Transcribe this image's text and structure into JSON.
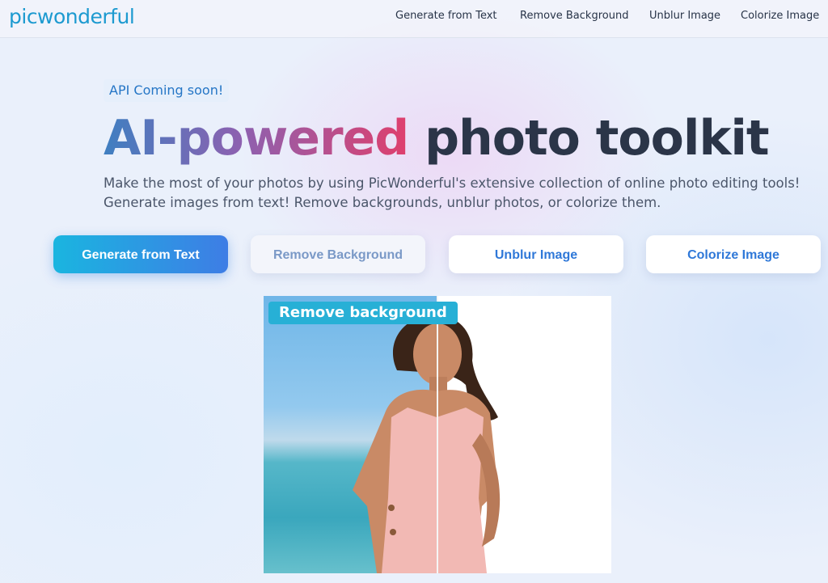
{
  "header": {
    "logo": "picwonderful",
    "nav": [
      "Generate from Text",
      "Remove Background",
      "Unblur Image",
      "Colorize Image"
    ]
  },
  "hero": {
    "badge": "API Coming soon!",
    "title_highlight": "AI-powered",
    "title_rest": "photo toolkit",
    "description_line1": "Make the most of your photos by using PicWonderful's extensive collection of online photo editing tools!",
    "description_line2": "Generate images from text! Remove backgrounds, unblur photos, or colorize them."
  },
  "tool_buttons": [
    "Generate from Text",
    "Remove Background",
    "Unblur Image",
    "Colorize Image"
  ],
  "demo": {
    "label": "Remove background",
    "image": "woman-in-pink-dress-photo"
  },
  "colors": {
    "brand": "#1d9ad0",
    "primary_button_start": "#1ab5e0",
    "primary_button_end": "#3e7de5",
    "title_dark": "#2b3548",
    "demo_label_bg": "#27b0d6"
  }
}
